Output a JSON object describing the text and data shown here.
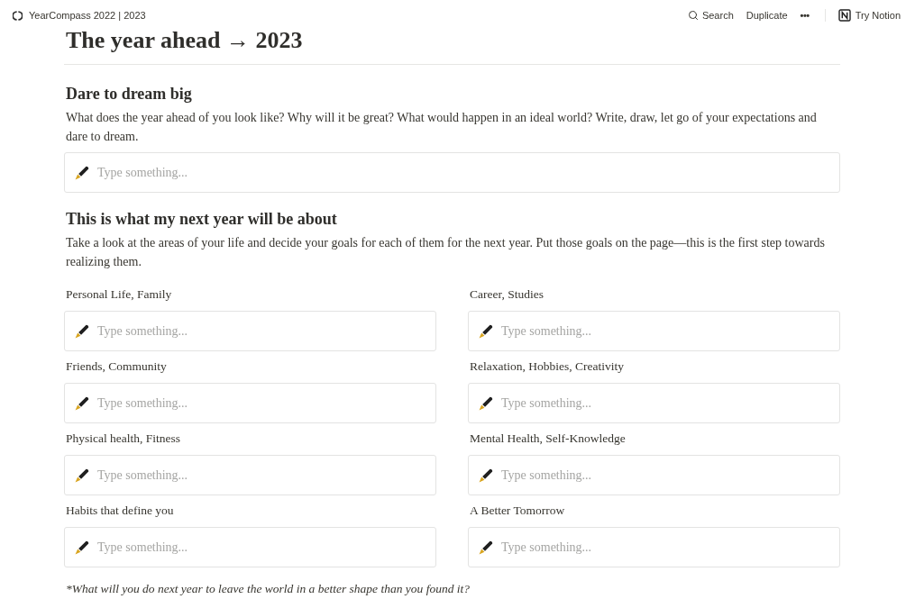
{
  "topbar": {
    "breadcrumb": "YearCompass 2022 | 2023",
    "actions": [
      {
        "kind": "search",
        "label": "Search"
      },
      {
        "kind": "plain",
        "label": "Duplicate"
      },
      {
        "kind": "more",
        "label": "•••"
      }
    ],
    "try_button": "Try Notion"
  },
  "page": {
    "title": "The year ahead → 2023"
  },
  "sections": [
    {
      "kind": "single",
      "heading": "Dare to dream big",
      "text": "What does the year ahead of you look like? Why will it be great? What would happen in an ideal world? Write, draw, let go of your expectations and dare to dream.",
      "fields": [
        {
          "placeholder": "Type something..."
        }
      ]
    },
    {
      "kind": "grid",
      "heading": "This is what my next year will be about",
      "text": "Take a look at the areas of your life and decide your goals for each of them for the next year. Put those goals on the page—this is the first step towards realizing them.",
      "fields": [
        {
          "label": "Personal Life, Family",
          "placeholder": "Type something..."
        },
        {
          "label": "Career, Studies",
          "placeholder": "Type something..."
        },
        {
          "label": "Friends, Community",
          "placeholder": "Type something..."
        },
        {
          "label": "Relaxation, Hobbies, Creativity",
          "placeholder": "Type something..."
        },
        {
          "label": "Physical health, Fitness",
          "placeholder": "Type something..."
        },
        {
          "label": "Mental Health, Self-Knowledge",
          "placeholder": "Type something..."
        },
        {
          "label": "Habits that define you",
          "placeholder": "Type something..."
        },
        {
          "label": "A Better Tomorrow",
          "placeholder": "Type something..."
        }
      ]
    }
  ],
  "footnote": "*What will you do next year to leave the world in a better shape than you found it?"
}
